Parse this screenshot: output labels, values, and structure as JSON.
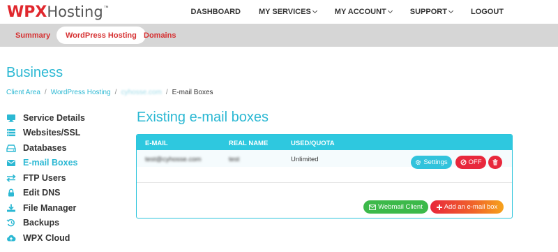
{
  "brand": {
    "wpx": "WPX",
    "hosting": "Hosting",
    "tm": "™"
  },
  "topnav": [
    {
      "label": "DASHBOARD",
      "dropdown": false
    },
    {
      "label": "MY SERVICES",
      "dropdown": true
    },
    {
      "label": "MY ACCOUNT",
      "dropdown": true
    },
    {
      "label": "SUPPORT",
      "dropdown": true
    },
    {
      "label": "LOGOUT",
      "dropdown": false
    }
  ],
  "subnav": [
    {
      "label": "Summary",
      "active": false
    },
    {
      "label": "WordPress Hosting",
      "active": true
    },
    {
      "label": "Domains",
      "active": false
    }
  ],
  "page": {
    "title": "Business"
  },
  "breadcrumb": {
    "items": [
      "Client Area",
      "WordPress Hosting",
      "cyhosse.com",
      "E-mail Boxes"
    ],
    "separator": "/"
  },
  "sidebar": {
    "items": [
      {
        "label": "Service Details",
        "icon": "monitor-icon",
        "active": false
      },
      {
        "label": "Websites/SSL",
        "icon": "list-icon",
        "active": false
      },
      {
        "label": "Databases",
        "icon": "hdd-icon",
        "active": false
      },
      {
        "label": "E-mail Boxes",
        "icon": "envelope-icon",
        "active": true
      },
      {
        "label": "FTP Users",
        "icon": "exchange-icon",
        "active": false
      },
      {
        "label": "Edit DNS",
        "icon": "lock-icon",
        "active": false
      },
      {
        "label": "File Manager",
        "icon": "download-icon",
        "active": false
      },
      {
        "label": "Backups",
        "icon": "history-icon",
        "active": false
      },
      {
        "label": "WPX Cloud",
        "icon": "cloud-upload-icon",
        "active": false
      }
    ]
  },
  "main": {
    "title": "Existing e-mail boxes"
  },
  "table": {
    "headers": [
      "E-MAIL",
      "REAL NAME",
      "USED/QUOTA"
    ],
    "rows": [
      {
        "email": "test@cyhosse.com",
        "real_name": "test",
        "quota": "Unlimited"
      }
    ]
  },
  "row_actions": {
    "settings": "Settings",
    "off": "OFF"
  },
  "footer_actions": {
    "webmail": "Webmail Client",
    "add": "Add an e-mail box"
  },
  "colors": {
    "brand_red": "#e0272d",
    "accent": "#2bb8d3",
    "success": "#3cb94a",
    "danger": "#e8283c"
  }
}
